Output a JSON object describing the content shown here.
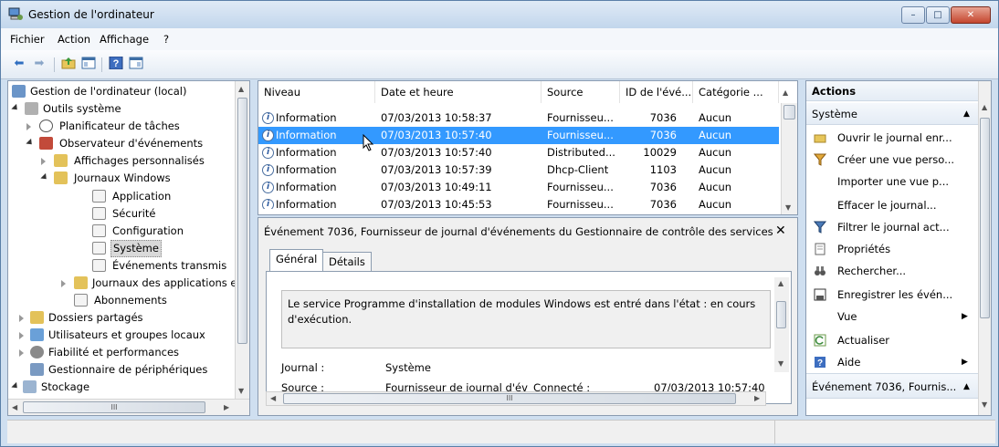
{
  "window": {
    "title": "Gestion de l'ordinateur",
    "minimize": "–",
    "maximize": "□",
    "close": "✕"
  },
  "menu": [
    "Fichier",
    "Action",
    "Affichage",
    "?"
  ],
  "tree": {
    "items": [
      {
        "label": "Gestion de l'ordinateur (local)"
      },
      {
        "label": "Outils système"
      },
      {
        "label": "Planificateur de tâches"
      },
      {
        "label": "Observateur d'événements"
      },
      {
        "label": "Affichages personnalisés"
      },
      {
        "label": "Journaux Windows"
      },
      {
        "label": "Application"
      },
      {
        "label": "Sécurité"
      },
      {
        "label": "Configuration"
      },
      {
        "label": "Système"
      },
      {
        "label": "Événements transmis"
      },
      {
        "label": "Journaux des applications e"
      },
      {
        "label": "Abonnements"
      },
      {
        "label": "Dossiers partagés"
      },
      {
        "label": "Utilisateurs et groupes locaux"
      },
      {
        "label": "Fiabilité et performances"
      },
      {
        "label": "Gestionnaire de périphériques"
      },
      {
        "label": "Stockage"
      }
    ],
    "hscroll_label": "III"
  },
  "list": {
    "columns": [
      "Niveau",
      "Date et heure",
      "Source",
      "ID de l'évé...",
      "Catégorie ..."
    ],
    "rows": [
      {
        "level": "Information",
        "date": "07/03/2013 10:58:37",
        "source": "Fournisseu...",
        "id": "7036",
        "cat": "Aucun"
      },
      {
        "level": "Information",
        "date": "07/03/2013 10:57:40",
        "source": "Fournisseu...",
        "id": "7036",
        "cat": "Aucun"
      },
      {
        "level": "Information",
        "date": "07/03/2013 10:57:40",
        "source": "Distributed...",
        "id": "10029",
        "cat": "Aucun"
      },
      {
        "level": "Information",
        "date": "07/03/2013 10:57:39",
        "source": "Dhcp-Client",
        "id": "1103",
        "cat": "Aucun"
      },
      {
        "level": "Information",
        "date": "07/03/2013 10:49:11",
        "source": "Fournisseu...",
        "id": "7036",
        "cat": "Aucun"
      },
      {
        "level": "Information",
        "date": "07/03/2013 10:45:53",
        "source": "Fournisseu...",
        "id": "7036",
        "cat": "Aucun"
      }
    ],
    "info_glyph": "i"
  },
  "detail": {
    "title": "Événement 7036, Fournisseur de journal d'événements du Gestionnaire de contrôle des services",
    "close": "✕",
    "tabs": [
      "Général",
      "Détails"
    ],
    "message": "Le service Programme d'installation de modules Windows est entré dans l'état : en cours d'exécution.",
    "journal_label": "Journal :",
    "journal_value": "Système",
    "source_label": "Source :",
    "source_value": "Fournisseur de journal d'év",
    "connected_label": "Connecté :",
    "connected_value": "07/03/2013 10:57:40",
    "hscroll_label": "III"
  },
  "actions": {
    "header": "Actions",
    "section1": "Système",
    "items": [
      {
        "label": "Ouvrir le journal enr...",
        "icon": "folder-open-icon"
      },
      {
        "label": "Créer une vue perso...",
        "icon": "filter-icon"
      },
      {
        "label": "Importer une vue p...",
        "icon": ""
      },
      {
        "label": "Effacer le journal...",
        "icon": ""
      },
      {
        "label": "Filtrer le journal act...",
        "icon": "filter-icon"
      },
      {
        "label": "Propriétés",
        "icon": "properties-icon"
      },
      {
        "label": "Rechercher...",
        "icon": "binoculars-icon"
      },
      {
        "label": "Enregistrer les évén...",
        "icon": "save-icon"
      },
      {
        "label": "Vue",
        "icon": ""
      },
      {
        "label": "Actualiser",
        "icon": "refresh-icon"
      },
      {
        "label": "Aide",
        "icon": "help-icon"
      }
    ],
    "section2": "Événement 7036, Fournis..."
  }
}
